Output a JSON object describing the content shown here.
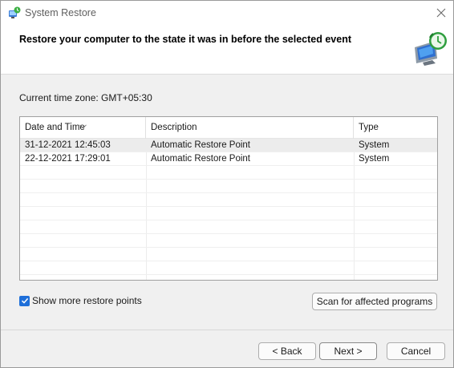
{
  "window": {
    "title": "System Restore",
    "app_icon": "system-restore-icon",
    "close_icon": "close-icon"
  },
  "header": {
    "heading": "Restore your computer to the state it was in before the selected event",
    "icon": "monitor-clock-restore-icon"
  },
  "timezone": {
    "text": "Current time zone: GMT+05:30"
  },
  "table": {
    "columns": [
      "Date and Time",
      "Description",
      "Type"
    ],
    "sort_column": "Date and Time",
    "sort_direction": "descending",
    "rows": [
      {
        "date": "31-12-2021 12:45:03",
        "description": "Automatic Restore Point",
        "type": "System",
        "selected": true
      },
      {
        "date": "22-12-2021 17:29:01",
        "description": "Automatic Restore Point",
        "type": "System",
        "selected": false
      }
    ]
  },
  "options": {
    "show_more_label": "Show more restore points",
    "show_more_checked": true
  },
  "buttons": {
    "scan": "Scan for affected programs",
    "back": "< Back",
    "next": "Next >",
    "cancel": "Cancel"
  },
  "colors": {
    "accent": "#1e6fd9",
    "selected_row": "#ececec",
    "dialog_bg": "#f0f0f0"
  }
}
